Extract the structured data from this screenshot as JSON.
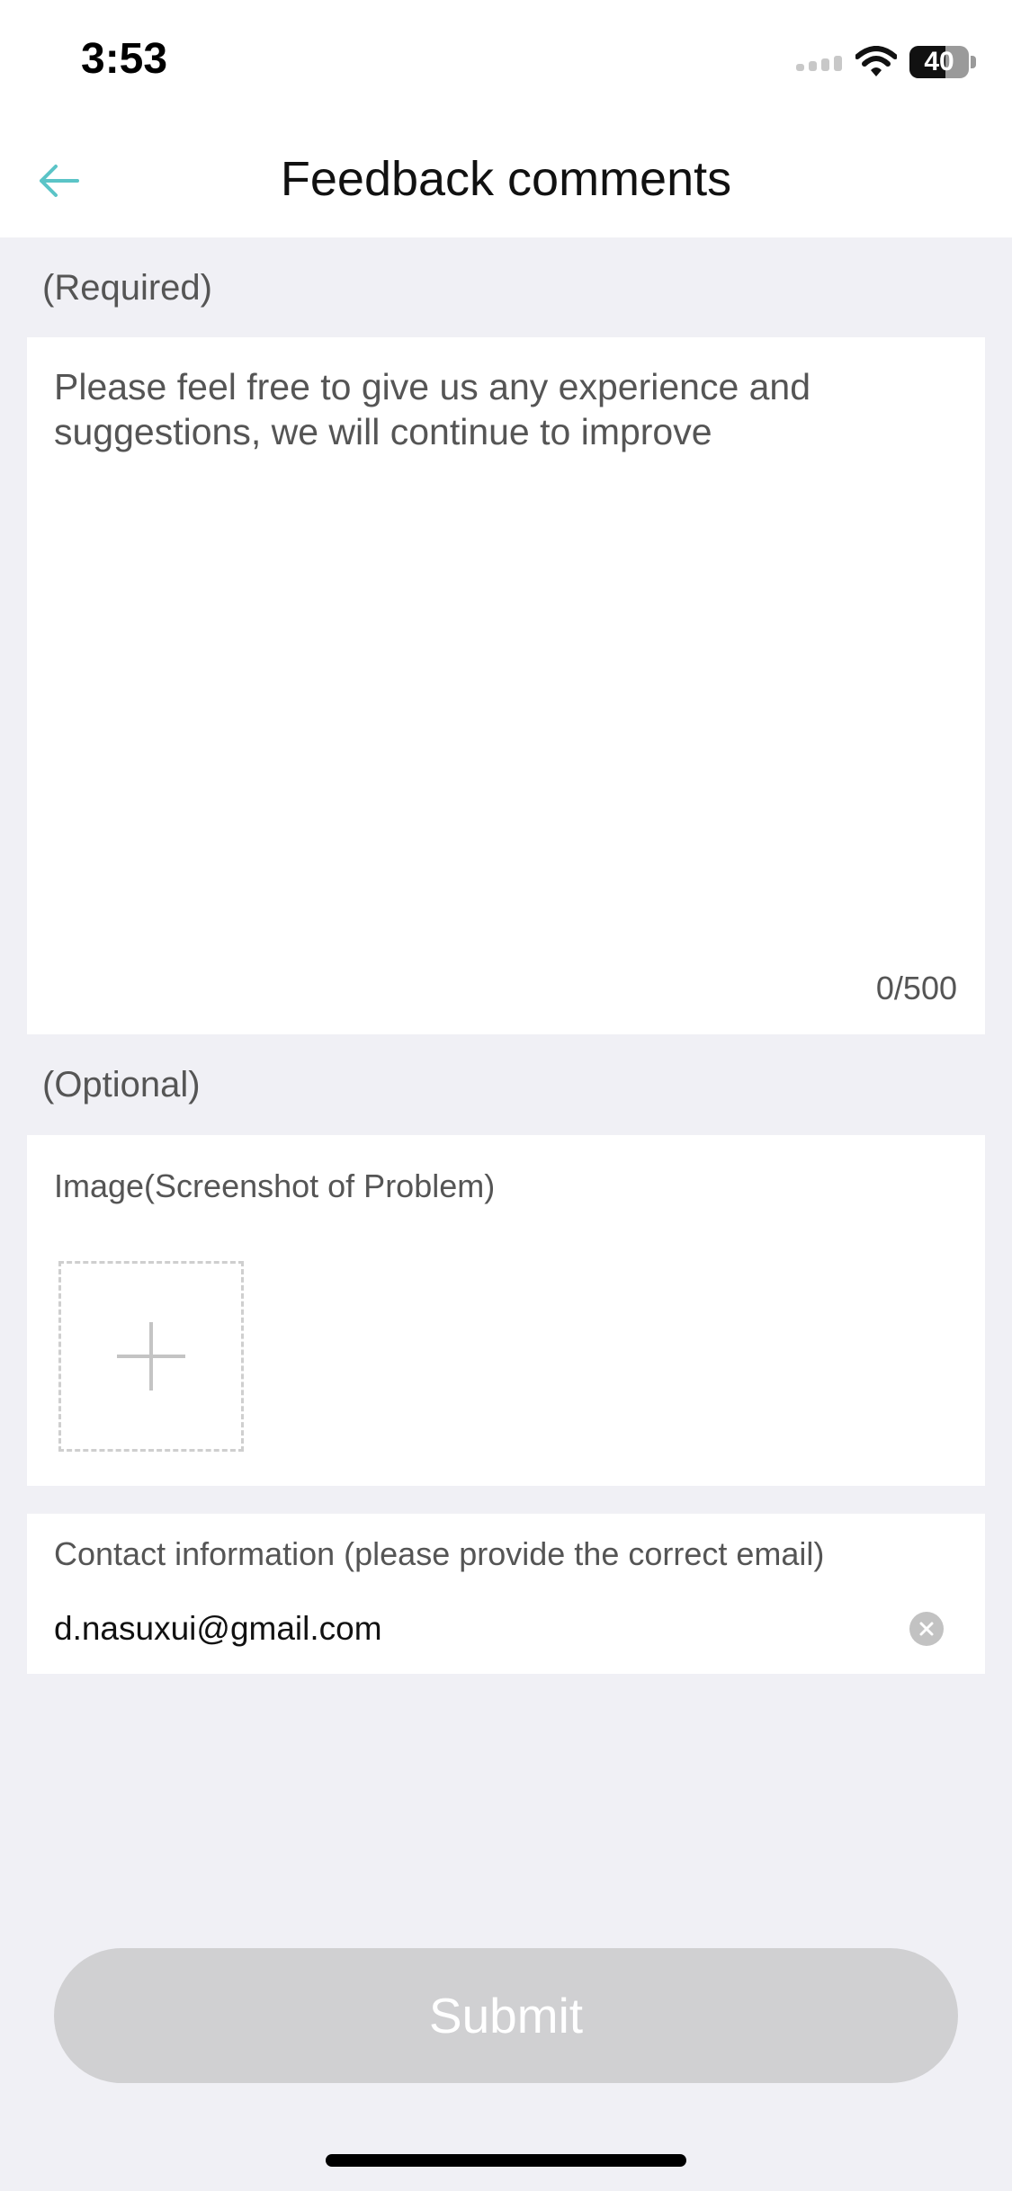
{
  "status_bar": {
    "time": "3:53",
    "battery_level": "40",
    "icons": [
      "cellular-signal-icon",
      "wifi-icon",
      "battery-icon"
    ]
  },
  "header": {
    "title": "Feedback comments",
    "back_icon": "arrow-left-icon",
    "accent_color": "#5bc4c7"
  },
  "feedback": {
    "section_label": "(Required)",
    "placeholder": "Please feel free to give us any experience and suggestions, we will continue to improve",
    "value": "",
    "counter": "0/500"
  },
  "optional": {
    "section_label": "(Optional)",
    "image_label": "Image(Screenshot of Problem)",
    "add_icon": "plus-icon"
  },
  "contact": {
    "label": "Contact information (please provide the correct email)",
    "value": "d.nasuxui@gmail.com",
    "clear_icon": "clear-circle-icon"
  },
  "submit": {
    "label": "Submit",
    "disabled_color": "#d0d0d2"
  }
}
